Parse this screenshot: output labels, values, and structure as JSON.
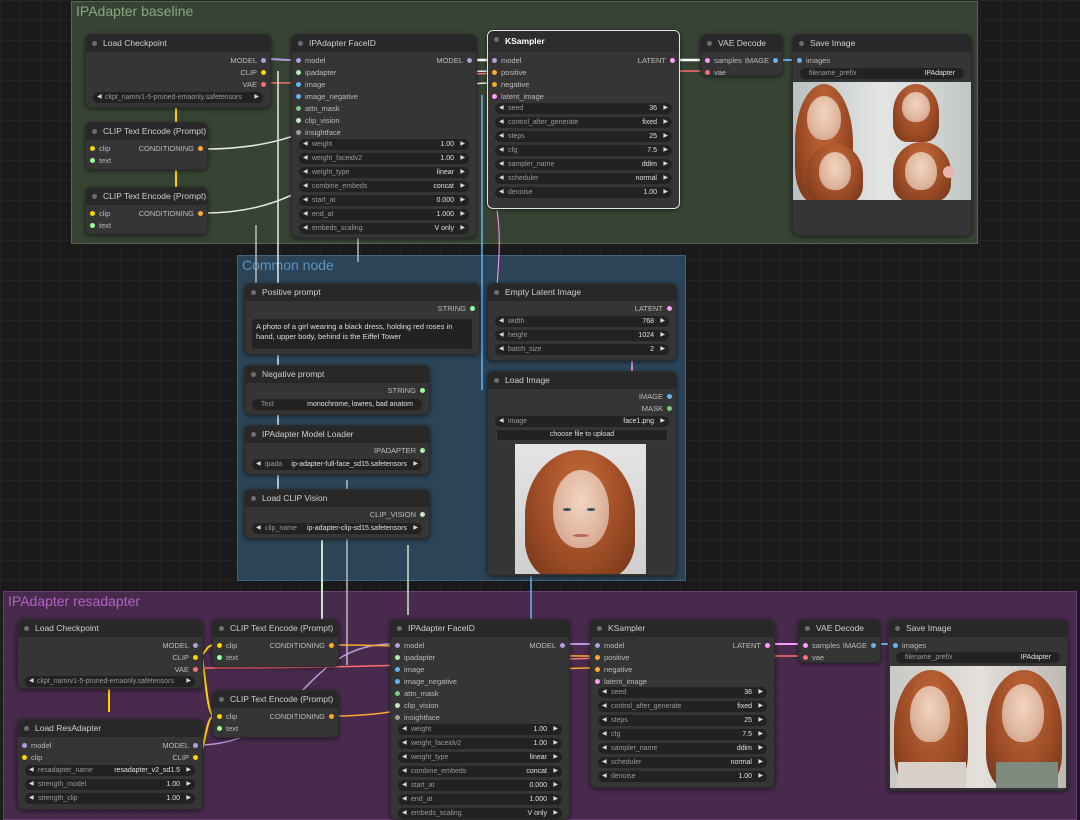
{
  "groups": {
    "baseline": "IPAdapter baseline",
    "common": "Common node",
    "resadapter": "IPAdapter resadapter"
  },
  "colors": {
    "model": "#b39ddb",
    "clip": "#ffd500",
    "vae": "#ff6e6e",
    "conditioning": "#ffa931",
    "latent": "#ff9cf9",
    "image": "#64b5f6",
    "ipadapter": "#afeeb4",
    "string": "#99ff99",
    "clip_vision": "#c8e6c9",
    "insightface": "#9e9e9e"
  },
  "top": {
    "load_checkpoint": {
      "title": "Load Checkpoint",
      "outputs": [
        "MODEL",
        "CLIP",
        "VAE"
      ],
      "ckpt": "ckpt_namrv1-5-pruned-emaonly.safetensors"
    },
    "clip1": {
      "title": "CLIP Text Encode (Prompt)",
      "inputs": [
        "clip",
        "text"
      ],
      "output": "CONDITIONING"
    },
    "clip2": {
      "title": "CLIP Text Encode (Prompt)",
      "inputs": [
        "clip",
        "text"
      ],
      "output": "CONDITIONING"
    },
    "ipadapter": {
      "title": "IPAdapter FaceID",
      "inputs": [
        "model",
        "ipadapter",
        "image",
        "image_negative",
        "attn_mask",
        "clip_vision",
        "insightface"
      ],
      "output": "MODEL",
      "widgets": [
        {
          "label": "weight",
          "value": "1.00"
        },
        {
          "label": "weight_faceidv2",
          "value": "1.00"
        },
        {
          "label": "weight_type",
          "value": "linear"
        },
        {
          "label": "combine_embeds",
          "value": "concat"
        },
        {
          "label": "start_at",
          "value": "0.000"
        },
        {
          "label": "end_at",
          "value": "1.000"
        },
        {
          "label": "embeds_scaling",
          "value": "V only"
        }
      ]
    },
    "ksampler": {
      "title": "KSampler",
      "inputs": [
        "model",
        "positive",
        "negative",
        "latent_image"
      ],
      "output": "LATENT",
      "widgets": [
        {
          "label": "seed",
          "value": "36"
        },
        {
          "label": "control_after_generate",
          "value": "fixed"
        },
        {
          "label": "steps",
          "value": "25"
        },
        {
          "label": "cfg",
          "value": "7.5"
        },
        {
          "label": "sampler_name",
          "value": "ddim"
        },
        {
          "label": "scheduler",
          "value": "normal"
        },
        {
          "label": "denoise",
          "value": "1.00"
        }
      ]
    },
    "vae_decode": {
      "title": "VAE Decode",
      "inputs": [
        "samples",
        "vae"
      ],
      "output": "IMAGE"
    },
    "save_image": {
      "title": "Save Image",
      "input": "images",
      "prefix_label": "filename_prefix",
      "prefix_value": "IPAdapter"
    }
  },
  "common": {
    "positive": {
      "title": "Positive prompt",
      "output": "STRING",
      "text": "A photo of a girl wearing a black dress, holding red roses in hand, upper body, behind is the Eiffel Tower"
    },
    "negative": {
      "title": "Negative prompt",
      "output": "STRING",
      "label": "Text",
      "value": "monochrome, lowres, bad anatom"
    },
    "ipa_loader": {
      "title": "IPAdapter Model Loader",
      "output": "IPADAPTER",
      "label": "ipada",
      "value": "ip-adapter-full-face_sd15.safetensors"
    },
    "clip_vision": {
      "title": "Load CLIP Vision",
      "output": "CLIP_VISION",
      "label": "clip_name",
      "value": "ip-adapter-clip-sd15.safetensors"
    },
    "empty_latent": {
      "title": "Empty Latent Image",
      "output": "LATENT",
      "widgets": [
        {
          "label": "width",
          "value": "768"
        },
        {
          "label": "height",
          "value": "1024"
        },
        {
          "label": "batch_size",
          "value": "2"
        }
      ]
    },
    "load_image": {
      "title": "Load Image",
      "outputs": [
        "IMAGE",
        "MASK"
      ],
      "label": "image",
      "value": "face1.png",
      "upload": "choose file to upload"
    }
  },
  "bottom": {
    "load_checkpoint": {
      "title": "Load Checkpoint",
      "outputs": [
        "MODEL",
        "CLIP",
        "VAE"
      ],
      "ckpt": "ckpt_namrv1-5-pruned-emaonly.safetensors"
    },
    "resadapter": {
      "title": "Load ResAdapter",
      "inputs": [
        "model",
        "clip"
      ],
      "outputs": [
        "MODEL",
        "CLIP"
      ],
      "widgets": [
        {
          "label": "resadapter_name",
          "value": "resadapter_v2_sd1.5"
        },
        {
          "label": "strength_model",
          "value": "1.00"
        },
        {
          "label": "strength_clip",
          "value": "1.00"
        }
      ]
    },
    "clip1": {
      "title": "CLIP Text Encode (Prompt)",
      "inputs": [
        "clip",
        "text"
      ],
      "output": "CONDITIONING"
    },
    "clip2": {
      "title": "CLIP Text Encode (Prompt)",
      "inputs": [
        "clip",
        "text"
      ],
      "output": "CONDITIONING"
    },
    "ipadapter": {
      "title": "IPAdapter FaceID",
      "inputs": [
        "model",
        "ipadapter",
        "image",
        "image_negative",
        "attn_mask",
        "clip_vision",
        "insightface"
      ],
      "output": "MODEL",
      "widgets": [
        {
          "label": "weight",
          "value": "1.00"
        },
        {
          "label": "weight_faceidv2",
          "value": "1.00"
        },
        {
          "label": "weight_type",
          "value": "linear"
        },
        {
          "label": "combine_embeds",
          "value": "concat"
        },
        {
          "label": "start_at",
          "value": "0.000"
        },
        {
          "label": "end_at",
          "value": "1.000"
        },
        {
          "label": "embeds_scaling",
          "value": "V only"
        }
      ]
    },
    "ksampler": {
      "title": "KSampler",
      "inputs": [
        "model",
        "positive",
        "negative",
        "latent_image"
      ],
      "output": "LATENT",
      "widgets": [
        {
          "label": "seed",
          "value": "36"
        },
        {
          "label": "control_after_generate",
          "value": "fixed"
        },
        {
          "label": "steps",
          "value": "25"
        },
        {
          "label": "cfg",
          "value": "7.5"
        },
        {
          "label": "sampler_name",
          "value": "ddim"
        },
        {
          "label": "scheduler",
          "value": "normal"
        },
        {
          "label": "denoise",
          "value": "1.00"
        }
      ]
    },
    "vae_decode": {
      "title": "VAE Decode",
      "inputs": [
        "samples",
        "vae"
      ],
      "output": "IMAGE"
    },
    "save_image": {
      "title": "Save Image",
      "input": "images",
      "prefix_label": "filename_prefix",
      "prefix_value": "IPAdapter"
    }
  }
}
